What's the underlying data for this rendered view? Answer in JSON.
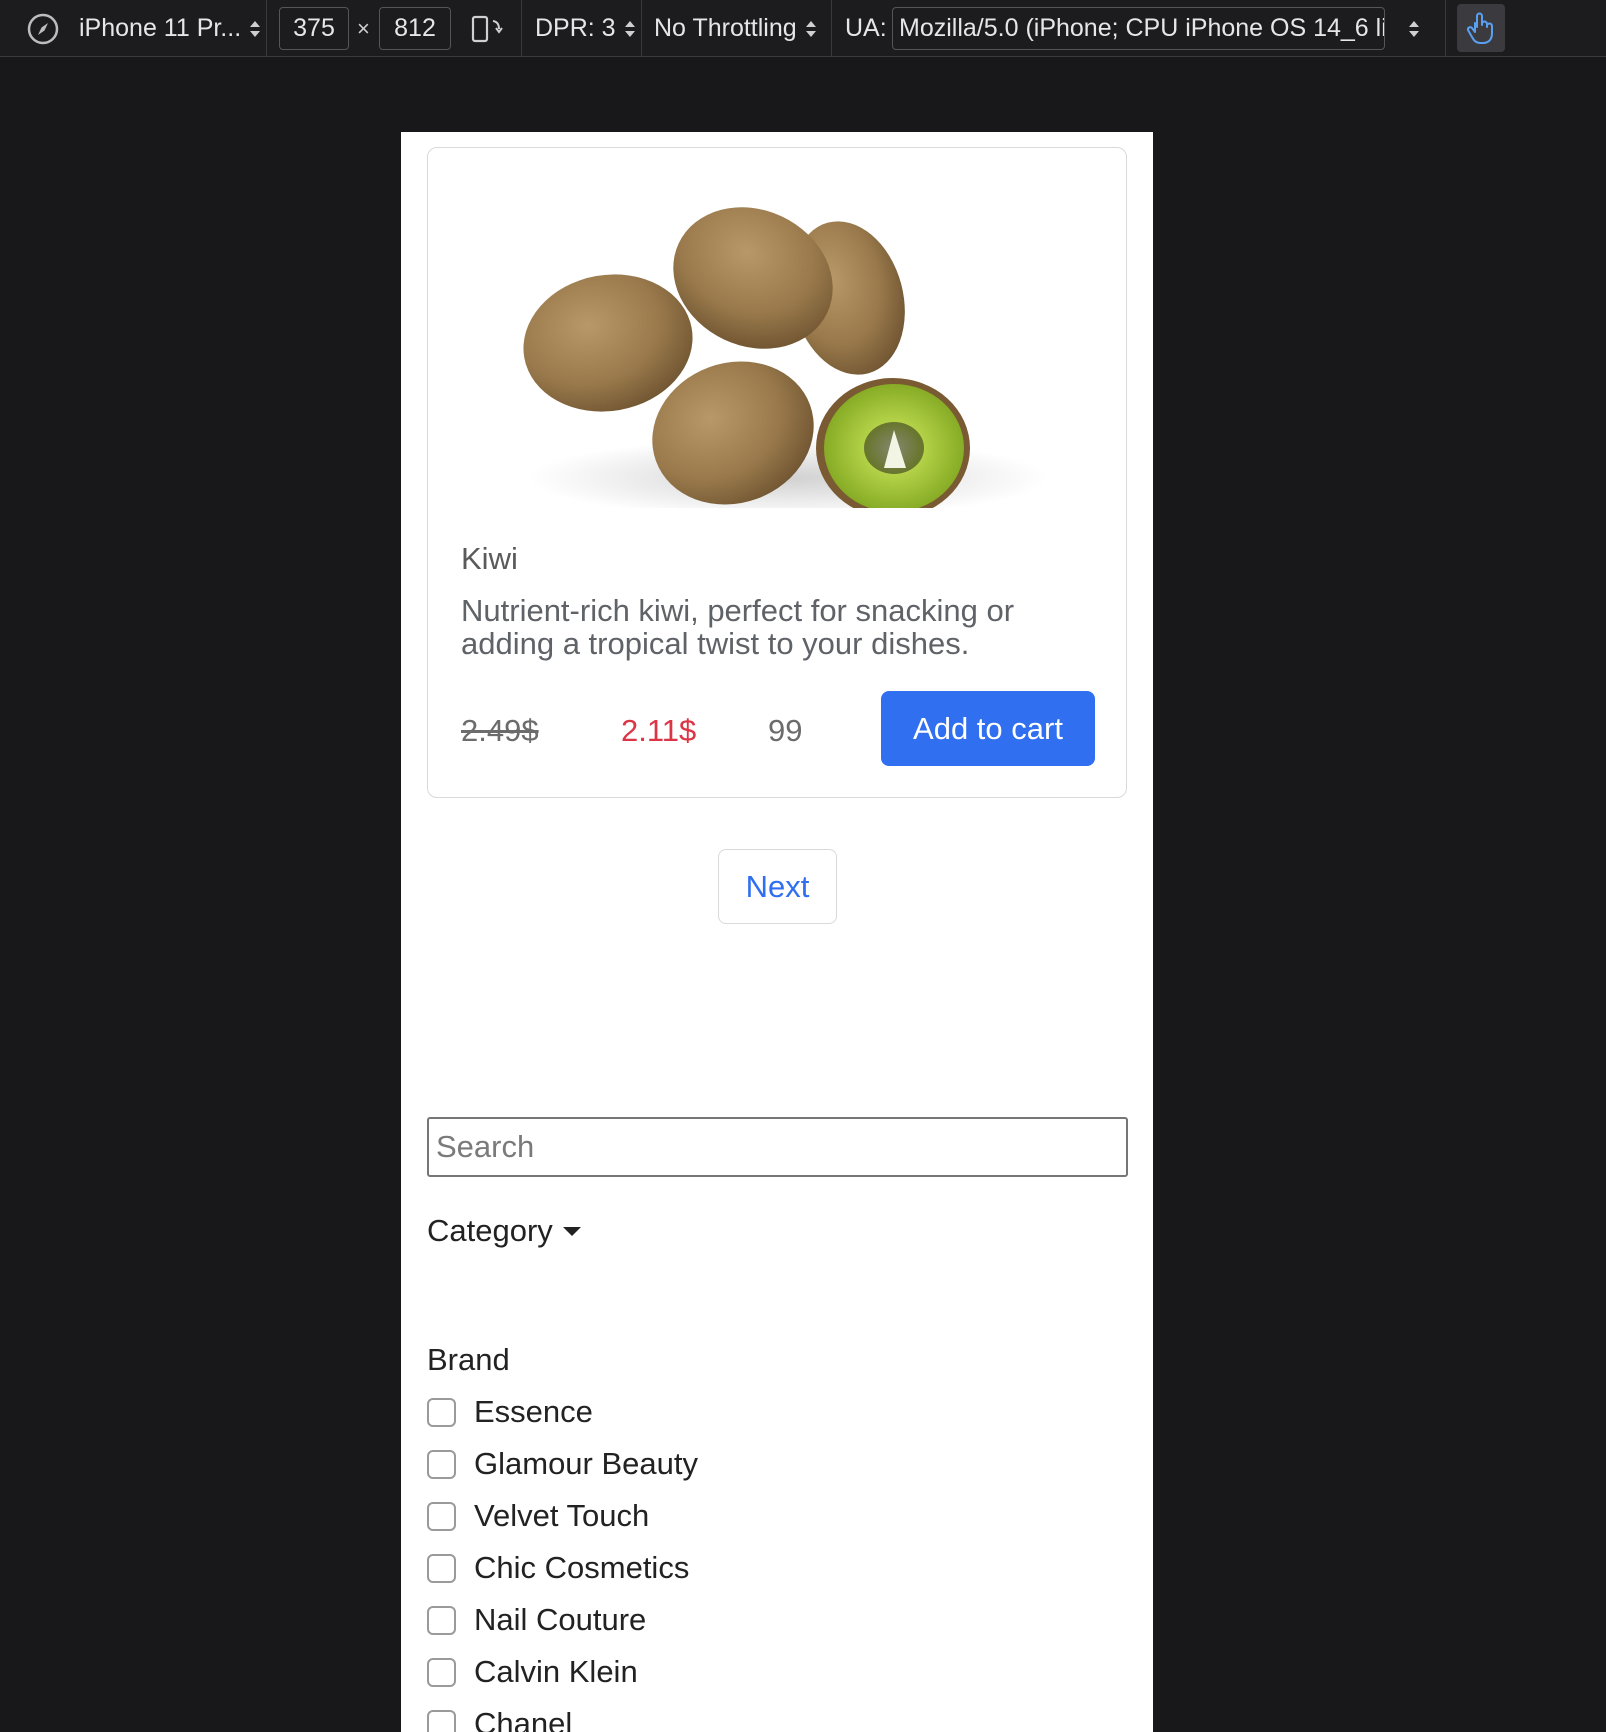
{
  "toolbar": {
    "device": "iPhone 11 Pr...",
    "width": "375",
    "times": "×",
    "height": "812",
    "dpr": "DPR: 3",
    "throttling": "No Throttling",
    "ua_label": "UA:",
    "ua_value": "Mozilla/5.0 (iPhone; CPU iPhone OS 14_6 li"
  },
  "product": {
    "title": "Kiwi",
    "description": "Nutrient-rich kiwi, perfect for snacking or adding a tropical twist to your dishes.",
    "old_price": "2.49$",
    "new_price": "2.11$",
    "stock": "99",
    "add_button": "Add to cart"
  },
  "pagination": {
    "next_label": "Next"
  },
  "filters": {
    "search_placeholder": "Search",
    "category_label": "Category",
    "brand_heading": "Brand",
    "brands": [
      {
        "label": "Essence",
        "checked": false
      },
      {
        "label": "Glamour Beauty",
        "checked": false
      },
      {
        "label": "Velvet Touch",
        "checked": false
      },
      {
        "label": "Chic Cosmetics",
        "checked": false
      },
      {
        "label": "Nail Couture",
        "checked": false
      },
      {
        "label": "Calvin Klein",
        "checked": false
      },
      {
        "label": "Chanel",
        "checked": false
      }
    ]
  },
  "colors": {
    "primary": "#2f6ff0",
    "sale_price": "#dc3545",
    "background": "#18181a"
  }
}
